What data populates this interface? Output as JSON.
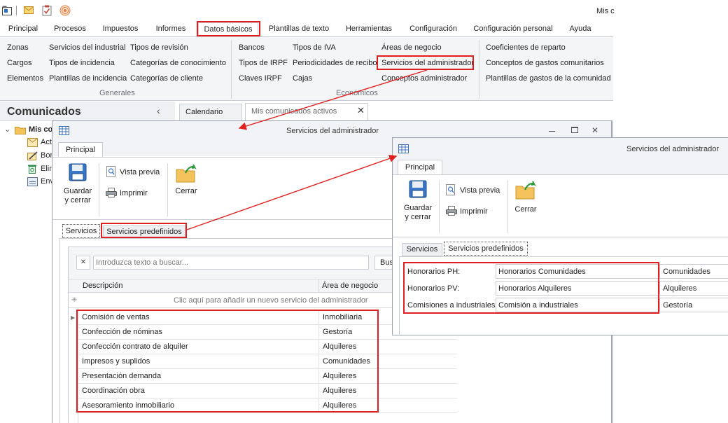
{
  "app": {
    "top_right_text": "Mis c",
    "colors": {
      "highlight": "#e02020",
      "ribbon_bg": "#f4f5f7",
      "window_header": "#f1f3f6"
    }
  },
  "quick_access": [
    "app-menu-icon",
    "mail-icon",
    "clipboard-check-icon",
    "rss-icon"
  ],
  "menu": {
    "tabs": [
      "Principal",
      "Procesos",
      "Impuestos",
      "Informes",
      "Datos básicos",
      "Plantillas de texto",
      "Herramientas",
      "Configuración",
      "Configuración personal",
      "Ayuda"
    ],
    "selected": "Datos básicos"
  },
  "ribbon": {
    "generales": {
      "col1": [
        "Zonas",
        "Cargos",
        "Elementos"
      ],
      "col2": [
        "Servicios del industrial",
        "Tipos de incidencia",
        "Plantillas de incidencia"
      ],
      "col3": [
        "Tipos de revisión",
        "Categorías de conocimiento",
        "Categorías de cliente"
      ],
      "label": "Generales"
    },
    "economicos": {
      "col1": [
        "Bancos",
        "Tipos de IRPF",
        "Claves IRPF"
      ],
      "col2": [
        "Tipos de IVA",
        "Periodicidades de recibo",
        "Cajas"
      ],
      "col3": [
        "Áreas de negocio",
        "Servicios del administrador",
        "Conceptos administrador"
      ],
      "label": "Económicos"
    },
    "right": [
      "Coeficientes de reparto",
      "Conceptos de gastos comunitarios",
      "Plantillas de gastos de la comunidad"
    ]
  },
  "sidebar": {
    "title": "Comunicados",
    "collapse_glyph": "‹",
    "root": "Mis co",
    "items": [
      "Act",
      "Bor",
      "Elim",
      "Env"
    ]
  },
  "doc_tabs": [
    "Calendario",
    "Mis comunicados activos"
  ],
  "win1": {
    "title": "Servicios del administrador",
    "ribbon_tab": "Principal",
    "buttons": {
      "save": "Guardar\ny cerrar",
      "preview": "Vista previa",
      "print": "Imprimir",
      "close": "Cerrar"
    },
    "tabs": [
      "Servicios",
      "Servicios predefinidos"
    ],
    "search_placeholder": "Introduzca texto a buscar...",
    "search_button": "Bus",
    "columns": [
      "Descripción",
      "Área de negocio"
    ],
    "new_row_hint": "Clic aquí para añadir un nuevo servicio del administrador",
    "rows": [
      {
        "desc": "Comisión de ventas",
        "area": "Inmobiliaria"
      },
      {
        "desc": "Confección de nóminas",
        "area": "Gestoría"
      },
      {
        "desc": "Confección contrato de alquiler",
        "area": "Alquileres"
      },
      {
        "desc": "Impresos y suplidos",
        "area": "Comunidades"
      },
      {
        "desc": "Presentación demanda",
        "area": "Alquileres"
      },
      {
        "desc": "Coordinación obra",
        "area": "Alquileres"
      },
      {
        "desc": "Asesoramiento inmobiliario",
        "area": "Alquileres"
      }
    ]
  },
  "win2": {
    "title": "Servicios del administrador",
    "ribbon_tab": "Principal",
    "buttons": {
      "save": "Guardar\ny cerrar",
      "preview": "Vista previa",
      "print": "Imprimir",
      "close": "Cerrar"
    },
    "tabs": [
      "Servicios",
      "Servicios predefinidos"
    ],
    "fields": [
      {
        "label": "Honorarios PH:",
        "value": "Honorarios Comunidades",
        "area": "Comunidades"
      },
      {
        "label": "Honorarios PV:",
        "value": "Honorarios Alquileres",
        "area": "Alquileres"
      },
      {
        "label": "Comisiones a industriales:",
        "value": "Comisión a industriales",
        "area": "Gestoría"
      }
    ]
  }
}
